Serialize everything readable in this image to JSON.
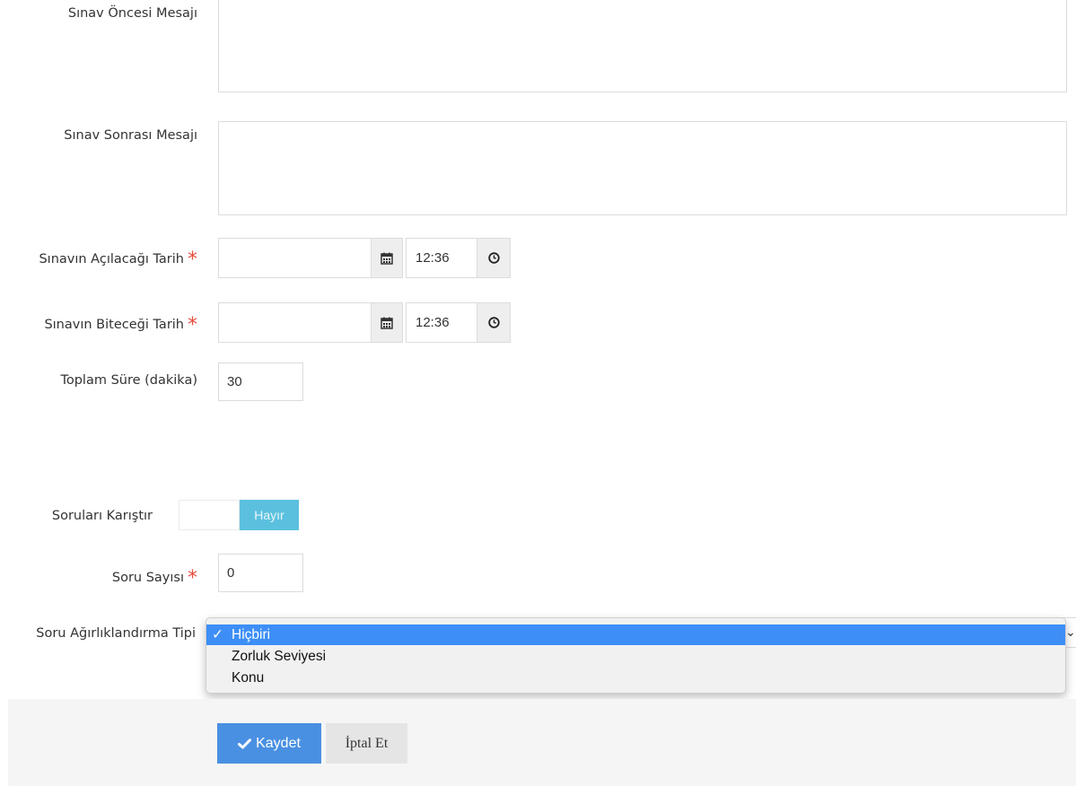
{
  "form": {
    "pre_message": {
      "label": "Sınav Öncesi Mesajı",
      "value": ""
    },
    "post_message": {
      "label": "Sınav Sonrası Mesajı",
      "value": ""
    },
    "open_date": {
      "label": "Sınavın Açılacağı Tarih",
      "required": "*",
      "date": "",
      "time": "12:36"
    },
    "close_date": {
      "label": "Sınavın Biteceği Tarih",
      "required": "*",
      "date": "",
      "time": "12:36"
    },
    "duration": {
      "label": "Toplam Süre (dakika)",
      "value": "30"
    },
    "shuffle": {
      "label": "Soruları Karıştır",
      "state_label": "Hayır"
    },
    "question_count": {
      "label": "Soru Sayısı",
      "required": "*",
      "value": "0"
    },
    "weighting": {
      "label": "Soru Ağırlıklandırma Tipi",
      "selected_mark": "✓",
      "options": [
        "Hiçbiri",
        "Zorluk Seviyesi",
        "Konu"
      ]
    }
  },
  "footer": {
    "save_label": "Kaydet",
    "cancel_label": "İptal Et"
  },
  "icons": {
    "calendar": "calendar-icon",
    "clock": "clock-icon",
    "check": "check-icon"
  },
  "colors": {
    "primary": "#4a90e2",
    "toggle_on": "#5bc0de",
    "selected_option": "#3d8ff7",
    "required": "#e74c3c"
  }
}
